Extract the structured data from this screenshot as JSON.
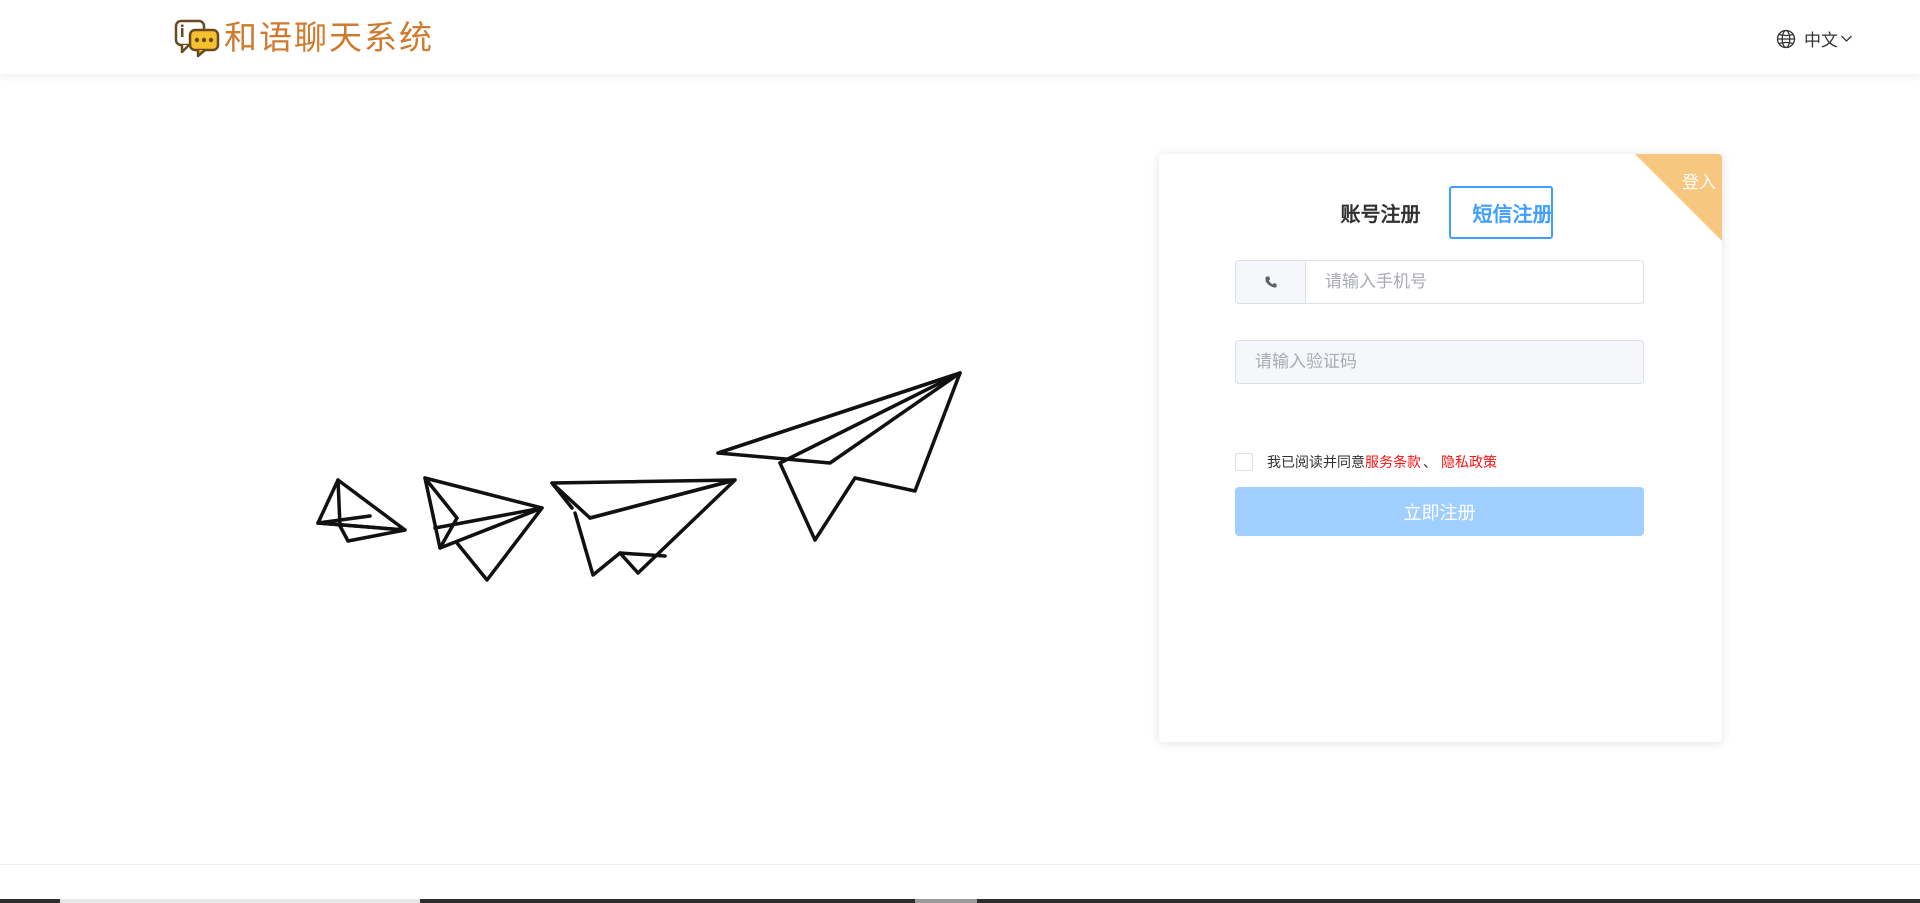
{
  "header": {
    "app_title": "和语聊天系统",
    "logo_icon": "chat-bubble-icon",
    "language": {
      "label": "中文",
      "icon": "globe-icon",
      "chevron": "chevron-down-icon"
    }
  },
  "hero": {
    "illustration": "paper-planes-illustration"
  },
  "card": {
    "corner_label": "登入",
    "tabs": [
      {
        "label": "账号注册",
        "active": false
      },
      {
        "label": "短信注册",
        "active": true
      }
    ],
    "phone": {
      "placeholder": "请输入手机号",
      "value": "",
      "icon": "phone-icon"
    },
    "code": {
      "placeholder": "请输入验证码",
      "value": ""
    },
    "agreement": {
      "checked": false,
      "text": "我已阅读并同意",
      "terms": "服务条款",
      "separator": "、",
      "privacy": "隐私政策"
    },
    "submit_label": "立即注册"
  },
  "colors": {
    "brand": "#cf7a2d",
    "accent": "#409eff",
    "submit_disabled": "#a0cfff",
    "corner": "#f7c780",
    "link": "#ff1111"
  }
}
